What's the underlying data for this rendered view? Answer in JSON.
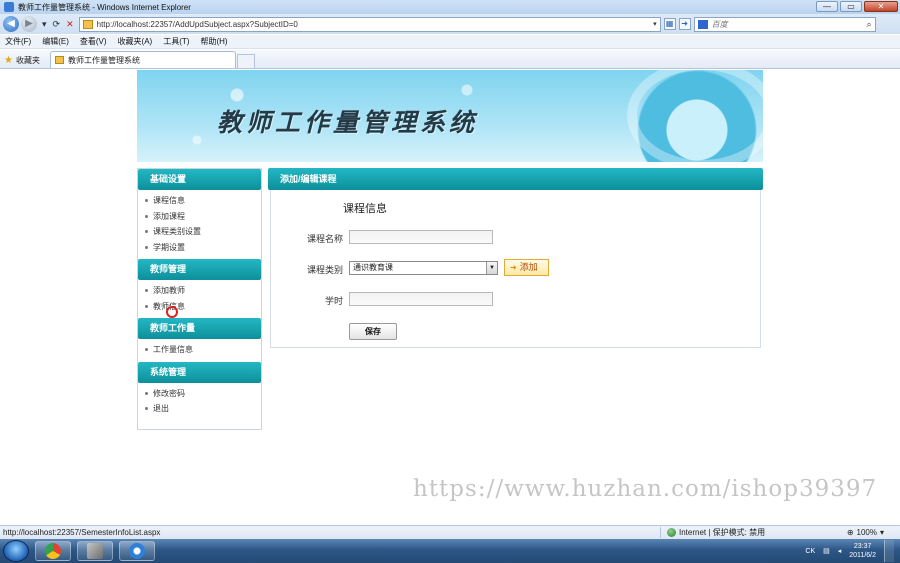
{
  "window": {
    "title": "教师工作量管理系统 - Windows Internet Explorer",
    "minimize": "—",
    "restore": "▭",
    "close": "✕"
  },
  "address_bar": {
    "url": "http://localhost:22357/AddUpdSubject.aspx?SubjectID=0",
    "search_placeholder": "百度"
  },
  "menu": [
    "文件(F)",
    "编辑(E)",
    "查看(V)",
    "收藏夹(A)",
    "工具(T)",
    "帮助(H)"
  ],
  "favorites_label": "收藏夹",
  "tab_title": "教师工作量管理系统",
  "banner_title": "教师工作量管理系统",
  "sidebar": {
    "groups": [
      {
        "title": "基础设置",
        "items": [
          "课程信息",
          "添加课程",
          "课程类别设置",
          "学期设置"
        ]
      },
      {
        "title": "教师管理",
        "items": [
          "添加教师",
          "教师信息"
        ]
      },
      {
        "title": "教师工作量",
        "items": [
          "工作量信息"
        ]
      },
      {
        "title": "系统管理",
        "items": [
          "修改密码",
          "退出"
        ]
      }
    ]
  },
  "content": {
    "header": "添加/编辑课程",
    "section_title": "课程信息",
    "fields": {
      "course_name_label": "课程名称",
      "course_name_value": "",
      "course_type_label": "课程类别",
      "course_type_value": "通识教育课",
      "add_button": "添加",
      "hours_label": "学时",
      "hours_value": "",
      "save_button": "保存"
    }
  },
  "watermark": "https://www.huzhan.com/ishop39397",
  "status_bar": {
    "url": "http://localhost:22357/SemesterInfoList.aspx",
    "zone": "Internet | 保护模式: 禁用",
    "zoom": "100%"
  },
  "taskbar": {
    "lang": "CK",
    "time": "23:37",
    "date": "2011/6/2"
  },
  "colors": {
    "teal_header": "#0d8f9a",
    "banner_sky": "#7fd4ef",
    "add_button_text": "#b24a00"
  }
}
